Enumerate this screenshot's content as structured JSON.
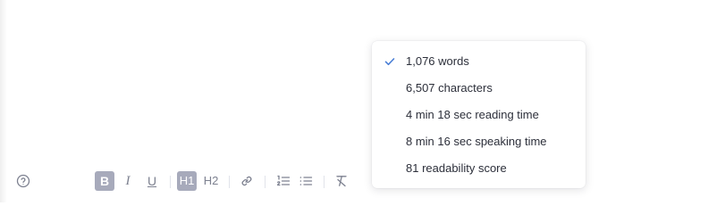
{
  "toolbar": {
    "help_icon": "help-circle-icon",
    "bold_label": "B",
    "italic_label": "I",
    "underline_label": "U",
    "heading1_label": "H1",
    "heading2_label": "H2",
    "link_icon": "link-icon",
    "ordered_list_icon": "ordered-list-icon",
    "bullet_list_icon": "bullet-list-icon",
    "clear_format_icon": "clear-format-icon",
    "active_buttons": [
      "bold",
      "heading1"
    ]
  },
  "stats_menu": {
    "items": [
      {
        "label": "1,076 words",
        "checked": true
      },
      {
        "label": "6,507 characters",
        "checked": false
      },
      {
        "label": "4 min 18 sec reading time",
        "checked": false
      },
      {
        "label": "8 min 16 sec speaking time",
        "checked": false
      },
      {
        "label": "81 readability score",
        "checked": false
      }
    ]
  },
  "colors": {
    "active_button_bg": "#a7aabb",
    "icon_gray": "#7d8190",
    "check_blue": "#4a7fd6"
  }
}
